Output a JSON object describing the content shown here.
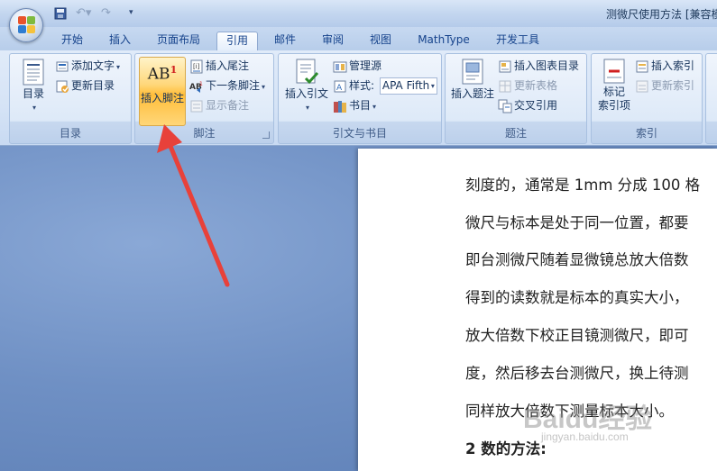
{
  "window": {
    "title": "测微尺使用方法 [兼容模"
  },
  "quick_access": {
    "save_icon": "save-icon",
    "undo_icon": "undo-icon",
    "redo_icon": "redo-icon",
    "customize": "▾"
  },
  "tabs": [
    {
      "label": "开始"
    },
    {
      "label": "插入"
    },
    {
      "label": "页面布局"
    },
    {
      "label": "引用",
      "active": true
    },
    {
      "label": "邮件"
    },
    {
      "label": "审阅"
    },
    {
      "label": "视图"
    },
    {
      "label": "MathType"
    },
    {
      "label": "开发工具"
    }
  ],
  "ribbon": {
    "toc": {
      "label": "目录",
      "toc_button": "目录",
      "add_text": "添加文字",
      "update_toc": "更新目录"
    },
    "footnotes": {
      "label": "脚注",
      "insert_footnote": "插入脚注",
      "insert_endnote": "插入尾注",
      "next_footnote": "下一条脚注",
      "show_notes": "显示备注",
      "footnote_icon_text": "AB",
      "footnote_icon_sup": "1"
    },
    "citations": {
      "label": "引文与书目",
      "insert_citation": "插入引文",
      "manage_sources": "管理源",
      "style_label": "样式:",
      "style_value": "APA Fifth",
      "bibliography": "书目"
    },
    "captions": {
      "label": "题注",
      "insert_caption": "插入题注",
      "insert_table_of_figures": "插入图表目录",
      "update_table": "更新表格",
      "cross_reference": "交叉引用"
    },
    "index": {
      "label": "索引",
      "mark_entry_line1": "标记",
      "mark_entry_line2": "索引项",
      "insert_index": "插入索引",
      "update_index": "更新索引"
    }
  },
  "document": {
    "lines": [
      "刻度的，通常是 1mm 分成 100 格",
      "微尺与标本是处于同一位置，都要",
      "即台测微尺随着显微镜总放大倍数",
      "得到的读数就是标本的真实大小，",
      "放大倍数下校正目镜测微尺，即可",
      "度，然后移去台测微尺，换上待测",
      "同样放大倍数下测量标本大小。"
    ],
    "heading": "2 数的方法:"
  },
  "watermark": {
    "logo": "Baidu经验",
    "url": "jingyan.baidu.com"
  },
  "colors": {
    "accent_arrow": "#e8413a",
    "tab_text": "#15428b",
    "highlight_button": "#ffc94d"
  }
}
